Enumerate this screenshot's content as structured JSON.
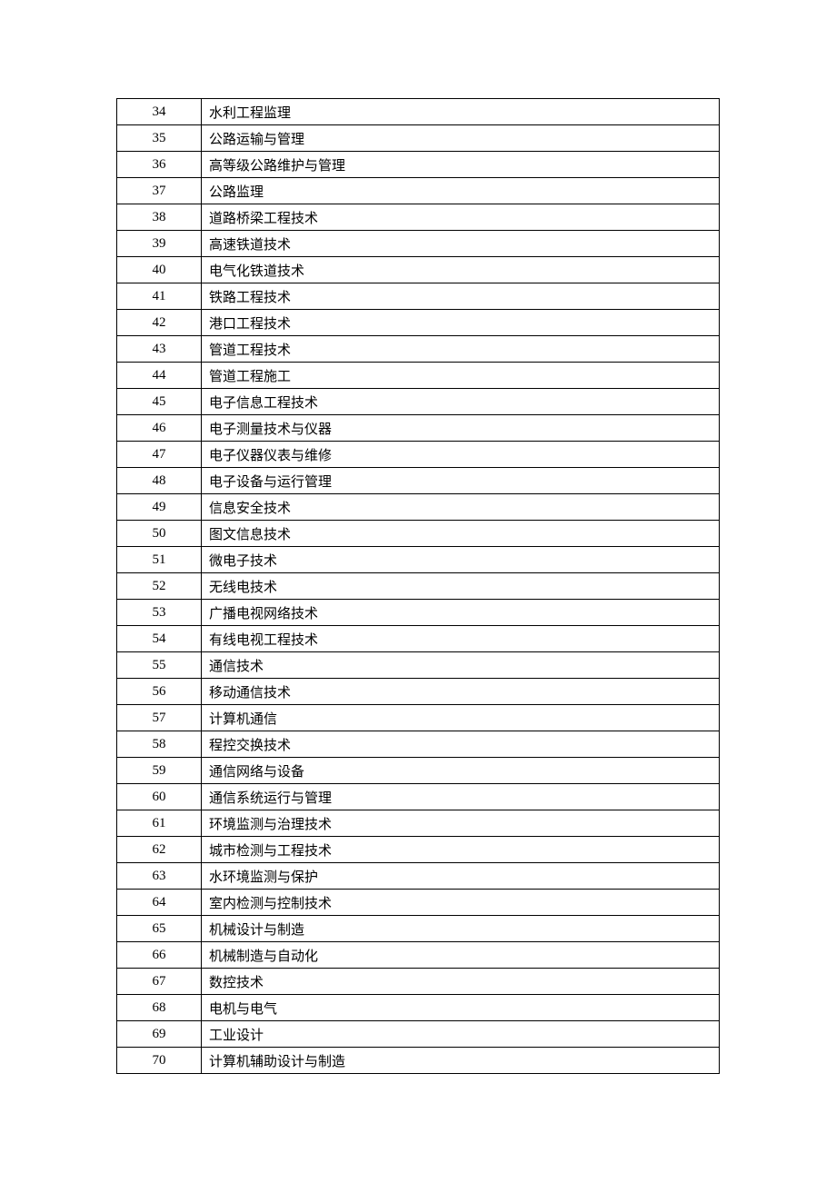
{
  "table": {
    "rows": [
      {
        "num": "34",
        "name": "水利工程监理"
      },
      {
        "num": "35",
        "name": "公路运输与管理"
      },
      {
        "num": "36",
        "name": "高等级公路维护与管理"
      },
      {
        "num": "37",
        "name": "公路监理"
      },
      {
        "num": "38",
        "name": "道路桥梁工程技术"
      },
      {
        "num": "39",
        "name": "高速铁道技术"
      },
      {
        "num": "40",
        "name": "电气化铁道技术"
      },
      {
        "num": "41",
        "name": "铁路工程技术"
      },
      {
        "num": "42",
        "name": "港口工程技术"
      },
      {
        "num": "43",
        "name": "管道工程技术"
      },
      {
        "num": "44",
        "name": "管道工程施工"
      },
      {
        "num": "45",
        "name": "电子信息工程技术"
      },
      {
        "num": "46",
        "name": "电子测量技术与仪器"
      },
      {
        "num": "47",
        "name": "电子仪器仪表与维修"
      },
      {
        "num": "48",
        "name": "电子设备与运行管理"
      },
      {
        "num": "49",
        "name": "信息安全技术"
      },
      {
        "num": "50",
        "name": "图文信息技术"
      },
      {
        "num": "51",
        "name": "微电子技术"
      },
      {
        "num": "52",
        "name": "无线电技术"
      },
      {
        "num": "53",
        "name": "广播电视网络技术"
      },
      {
        "num": "54",
        "name": "有线电视工程技术"
      },
      {
        "num": "55",
        "name": "通信技术"
      },
      {
        "num": "56",
        "name": "移动通信技术"
      },
      {
        "num": "57",
        "name": "计算机通信"
      },
      {
        "num": "58",
        "name": "程控交换技术"
      },
      {
        "num": "59",
        "name": "通信网络与设备"
      },
      {
        "num": "60",
        "name": "通信系统运行与管理"
      },
      {
        "num": "61",
        "name": "环境监测与治理技术"
      },
      {
        "num": "62",
        "name": "城市检测与工程技术"
      },
      {
        "num": "63",
        "name": "水环境监测与保护"
      },
      {
        "num": "64",
        "name": "室内检测与控制技术"
      },
      {
        "num": "65",
        "name": "机械设计与制造"
      },
      {
        "num": "66",
        "name": "机械制造与自动化"
      },
      {
        "num": "67",
        "name": "数控技术"
      },
      {
        "num": "68",
        "name": "电机与电气"
      },
      {
        "num": "69",
        "name": "工业设计"
      },
      {
        "num": "70",
        "name": "计算机辅助设计与制造"
      }
    ]
  }
}
